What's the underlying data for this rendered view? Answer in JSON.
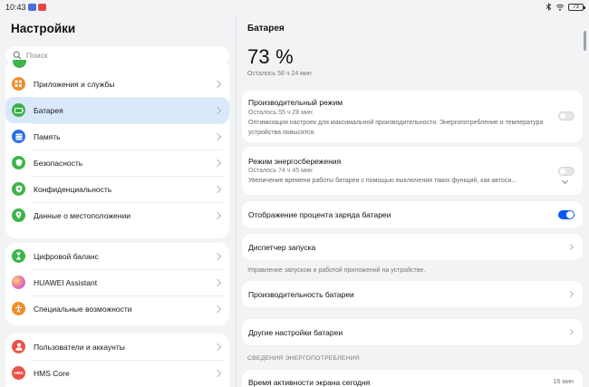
{
  "status_bar": {
    "time": "10:43",
    "battery": "73"
  },
  "left": {
    "title": "Настройки",
    "search_placeholder": "Поиск",
    "groups": [
      {
        "items": [
          {
            "label": "Приложения и службы",
            "icon": "apps-icon",
            "color": "#f08c2a"
          },
          {
            "label": "Батарея",
            "icon": "battery-icon",
            "color": "#3cb44a",
            "selected": true
          },
          {
            "label": "Память",
            "icon": "storage-icon",
            "color": "#2b6fe8"
          },
          {
            "label": "Безопасность",
            "icon": "shield-icon",
            "color": "#3cb44a"
          },
          {
            "label": "Конфиденциальность",
            "icon": "privacy-icon",
            "color": "#3cb44a"
          },
          {
            "label": "Данные о местоположении",
            "icon": "location-icon",
            "color": "#3cb44a"
          }
        ]
      },
      {
        "items": [
          {
            "label": "Цифровой баланс",
            "icon": "hourglass-icon",
            "color": "#3cb44a"
          },
          {
            "label": "HUAWEI Assistant",
            "icon": "assistant-icon",
            "color": "#b07be6"
          },
          {
            "label": "Специальные возможности",
            "icon": "accessibility-icon",
            "color": "#f08c2a"
          }
        ]
      },
      {
        "items": [
          {
            "label": "Пользователи и аккаунты",
            "icon": "user-icon",
            "color": "#e8534a"
          },
          {
            "label": "HMS Core",
            "icon": "hms-core-icon",
            "color": "#e8534a",
            "badge": "HMS"
          }
        ]
      }
    ]
  },
  "right": {
    "title": "Батарея",
    "percent": "73 %",
    "remaining": "Осталось 58 ч 24 мин",
    "performance": {
      "title": "Производительный режим",
      "sub": "Осталось 55 ч 28 мин",
      "desc": "Оптимизация настроек для максимальной производительности. Энергопотребление и температура устройства повысятся.",
      "enabled": false
    },
    "power_saving": {
      "title": "Режим энергосбережения",
      "sub": "Осталось 74 ч 45 мин",
      "desc": "Увеличение времени работы батареи с помощью выключения таких функций, как автоси...",
      "enabled": false
    },
    "show_percent": {
      "title": "Отображение процента заряда батареи",
      "enabled": true
    },
    "launch_manager": {
      "title": "Диспетчер запуска",
      "note": "Управление запуском и работой приложений на устройстве."
    },
    "battery_performance": {
      "title": "Производительность батареи"
    },
    "other_settings": {
      "title": "Другие настройки батареи"
    },
    "section_header": "СВЕДЕНИЯ ЭНЕРГОПОТРЕБЛЕНИЯ",
    "screen_time": {
      "title": "Время активности экрана сегодня",
      "value": "16 мин"
    }
  },
  "colors": {
    "accent": "#0a59f7",
    "selected_bg": "#d9e8fb"
  }
}
